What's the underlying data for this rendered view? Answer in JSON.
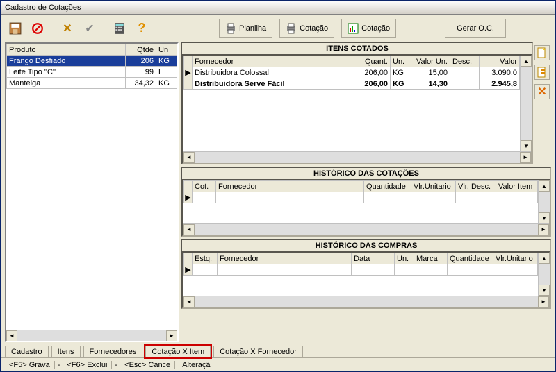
{
  "window": {
    "title": "Cadastro de Cotações"
  },
  "toolbar": {
    "planilha": "Planilha",
    "cotacao_print": "Cotação",
    "cotacao_chart": "Cotação",
    "gerar_oc": "Gerar O.C."
  },
  "left_grid": {
    "headers": {
      "produto": "Produto",
      "qtde": "Qtde",
      "un": "Un"
    },
    "rows": [
      {
        "produto": "Frango Desfiado",
        "qtde": "206",
        "un": "KG",
        "selected": true
      },
      {
        "produto": "Leite Tipo ''C''",
        "qtde": "99",
        "un": "L",
        "selected": false
      },
      {
        "produto": "Manteiga",
        "qtde": "34,32",
        "un": "KG",
        "selected": false
      }
    ]
  },
  "itens_cotados": {
    "title": "ITENS COTADOS",
    "headers": {
      "fornecedor": "Fornecedor",
      "quant": "Quant.",
      "un": "Un.",
      "valor_un": "Valor Un.",
      "desc": "Desc.",
      "valor": "Valor"
    },
    "rows": [
      {
        "marker": "▶",
        "fornecedor": "Distribuidora Colossal",
        "quant": "206,00",
        "un": "KG",
        "valor_un": "15,00",
        "desc": "",
        "valor": "3.090,0",
        "bold": false
      },
      {
        "marker": "",
        "fornecedor": "Distribuidora Serve Fácil",
        "quant": "206,00",
        "un": "KG",
        "valor_un": "14,30",
        "desc": "",
        "valor": "2.945,8",
        "bold": true
      }
    ]
  },
  "historico_cotacoes": {
    "title": "HISTÓRICO DAS COTAÇÕES",
    "headers": {
      "cot": "Cot.",
      "fornecedor": "Fornecedor",
      "quantidade": "Quantidade",
      "vlr_unitario": "Vlr.Unitario",
      "vlr_desc": "Vlr. Desc.",
      "valor_item": "Valor Item"
    }
  },
  "historico_compras": {
    "title": "HISTÓRICO DAS COMPRAS",
    "headers": {
      "estq": "Estq.",
      "fornecedor": "Fornecedor",
      "data": "Data",
      "un": "Un.",
      "marca": "Marca",
      "quantidade": "Quantidade",
      "vlr_unitario": "Vlr.Unitario"
    }
  },
  "tabs": {
    "cadastro": "Cadastro",
    "itens": "Itens",
    "fornecedores": "Fornecedores",
    "cotacao_x_item": "Cotação X Item",
    "cotacao_x_fornecedor": "Cotação X Fornecedor"
  },
  "status": {
    "f5": "<F5> Grava",
    "sep": "-",
    "f6": "<F6> Exclui",
    "esc": "<Esc> Cance",
    "alteracao": "Alteraçã"
  }
}
